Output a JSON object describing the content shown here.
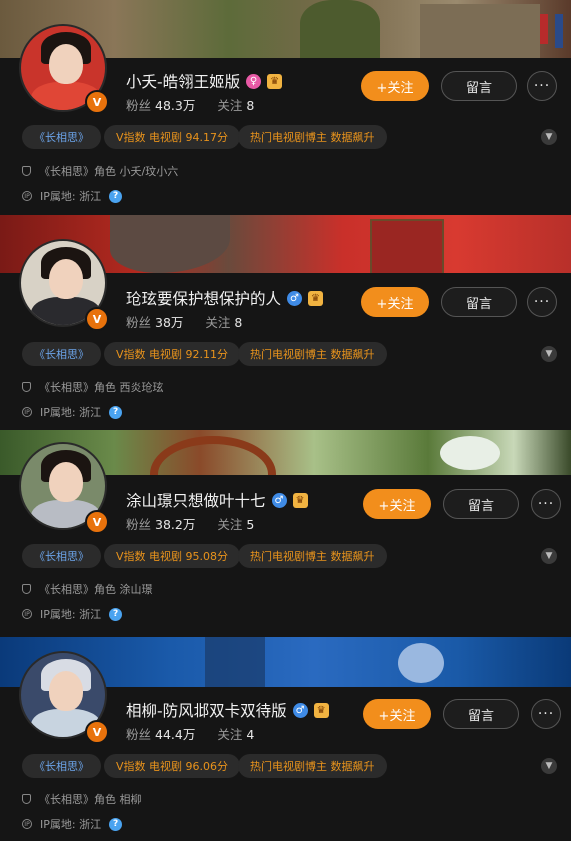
{
  "labels": {
    "fans": "粉丝",
    "following": "关注",
    "follow_button": "+关注",
    "message_button": "留言",
    "ip_label": "IP属地:",
    "more": "···"
  },
  "profiles": [
    {
      "name": "小夭-皓翎王姬版",
      "gender": "female",
      "fans": "48.3万",
      "following": "8",
      "tags": [
        "《长相思》",
        "V指数 电视剧 94.17分",
        "热门电视剧博主 数据飙升"
      ],
      "role_text": "《长相思》角色 小夭/玟小六",
      "ip_location": "浙江"
    },
    {
      "name": "玱玹要保护想保护的人",
      "gender": "male",
      "fans": "38万",
      "following": "8",
      "tags": [
        "《长相思》",
        "V指数 电视剧 92.11分",
        "热门电视剧博主 数据飙升"
      ],
      "role_text": "《长相思》角色 西炎玱玹",
      "ip_location": "浙江"
    },
    {
      "name": "涂山璟只想做叶十七",
      "gender": "male",
      "fans": "38.2万",
      "following": "5",
      "tags": [
        "《长相思》",
        "V指数 电视剧 95.08分",
        "热门电视剧博主 数据飙升"
      ],
      "role_text": "《长相思》角色 涂山璟",
      "ip_location": "浙江"
    },
    {
      "name": "相柳-防风邶双卡双待版",
      "gender": "male",
      "fans": "44.4万",
      "following": "4",
      "tags": [
        "《长相思》",
        "V指数 电视剧 96.06分",
        "热门电视剧博主 数据飙升"
      ],
      "role_text": "《长相思》角色 相柳",
      "ip_location": "浙江"
    }
  ],
  "colors": {
    "accent_orange": "#f28e1c",
    "tag_blue": "#6ba3e8",
    "tag_orange": "#e8931c",
    "background": "#151515"
  }
}
